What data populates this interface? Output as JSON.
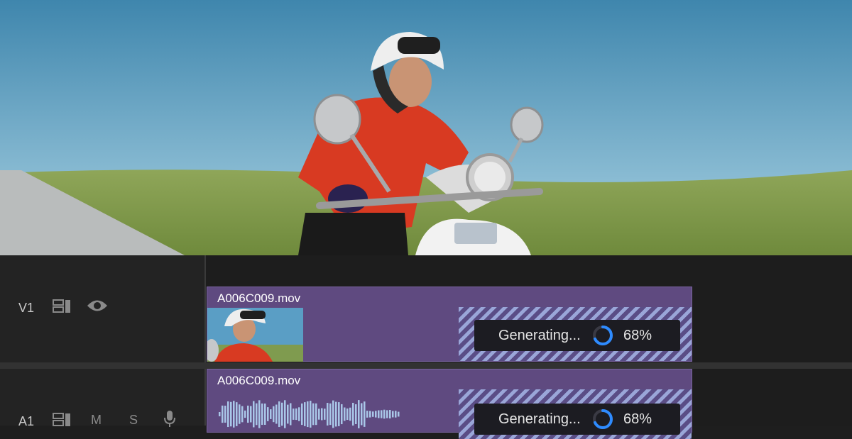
{
  "preview": {
    "image": "motor-scooter-rider-photo"
  },
  "timeline": {
    "tracks": [
      {
        "label": "V1",
        "controls": [
          "clip-settings-icon",
          "eye-icon"
        ],
        "clip": {
          "name": "A006C009.mov",
          "status": "Generating...",
          "progress_text": "68%",
          "progress": 0.68
        }
      },
      {
        "label": "A1",
        "controls": [
          "clip-settings-icon",
          "mute-M",
          "solo-S",
          "microphone-icon"
        ],
        "mute_label": "M",
        "solo_label": "S",
        "clip": {
          "name": "A006C009.mov",
          "status": "Generating...",
          "progress_text": "68%",
          "progress": 0.68
        }
      }
    ]
  },
  "colors": {
    "clip": "#5f4a80",
    "hatch_light": "#9aa6d8",
    "progress_ring": "#2e8bff",
    "panel": "#1e1e1e"
  }
}
